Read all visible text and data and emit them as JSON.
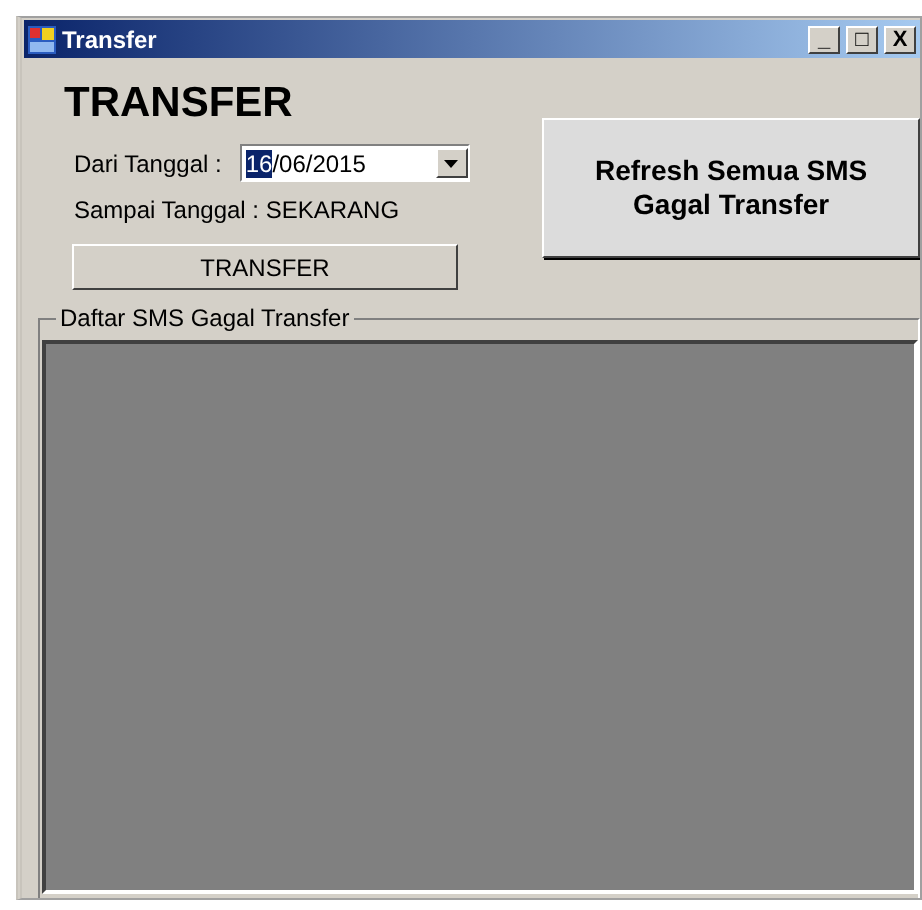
{
  "window": {
    "title": "Transfer",
    "controls": [
      "_",
      "□",
      "X"
    ]
  },
  "heading": "TRANSFER",
  "from_date": {
    "label": "Dari Tanggal :",
    "selected_text": "16",
    "text": "/06/2015"
  },
  "to_date_label": "Sampai Tanggal : SEKARANG",
  "transfer_button": "TRANSFER",
  "refresh_button": "Refresh Semua SMS Gagal Transfer",
  "group": {
    "title": "Daftar SMS Gagal Transfer"
  }
}
